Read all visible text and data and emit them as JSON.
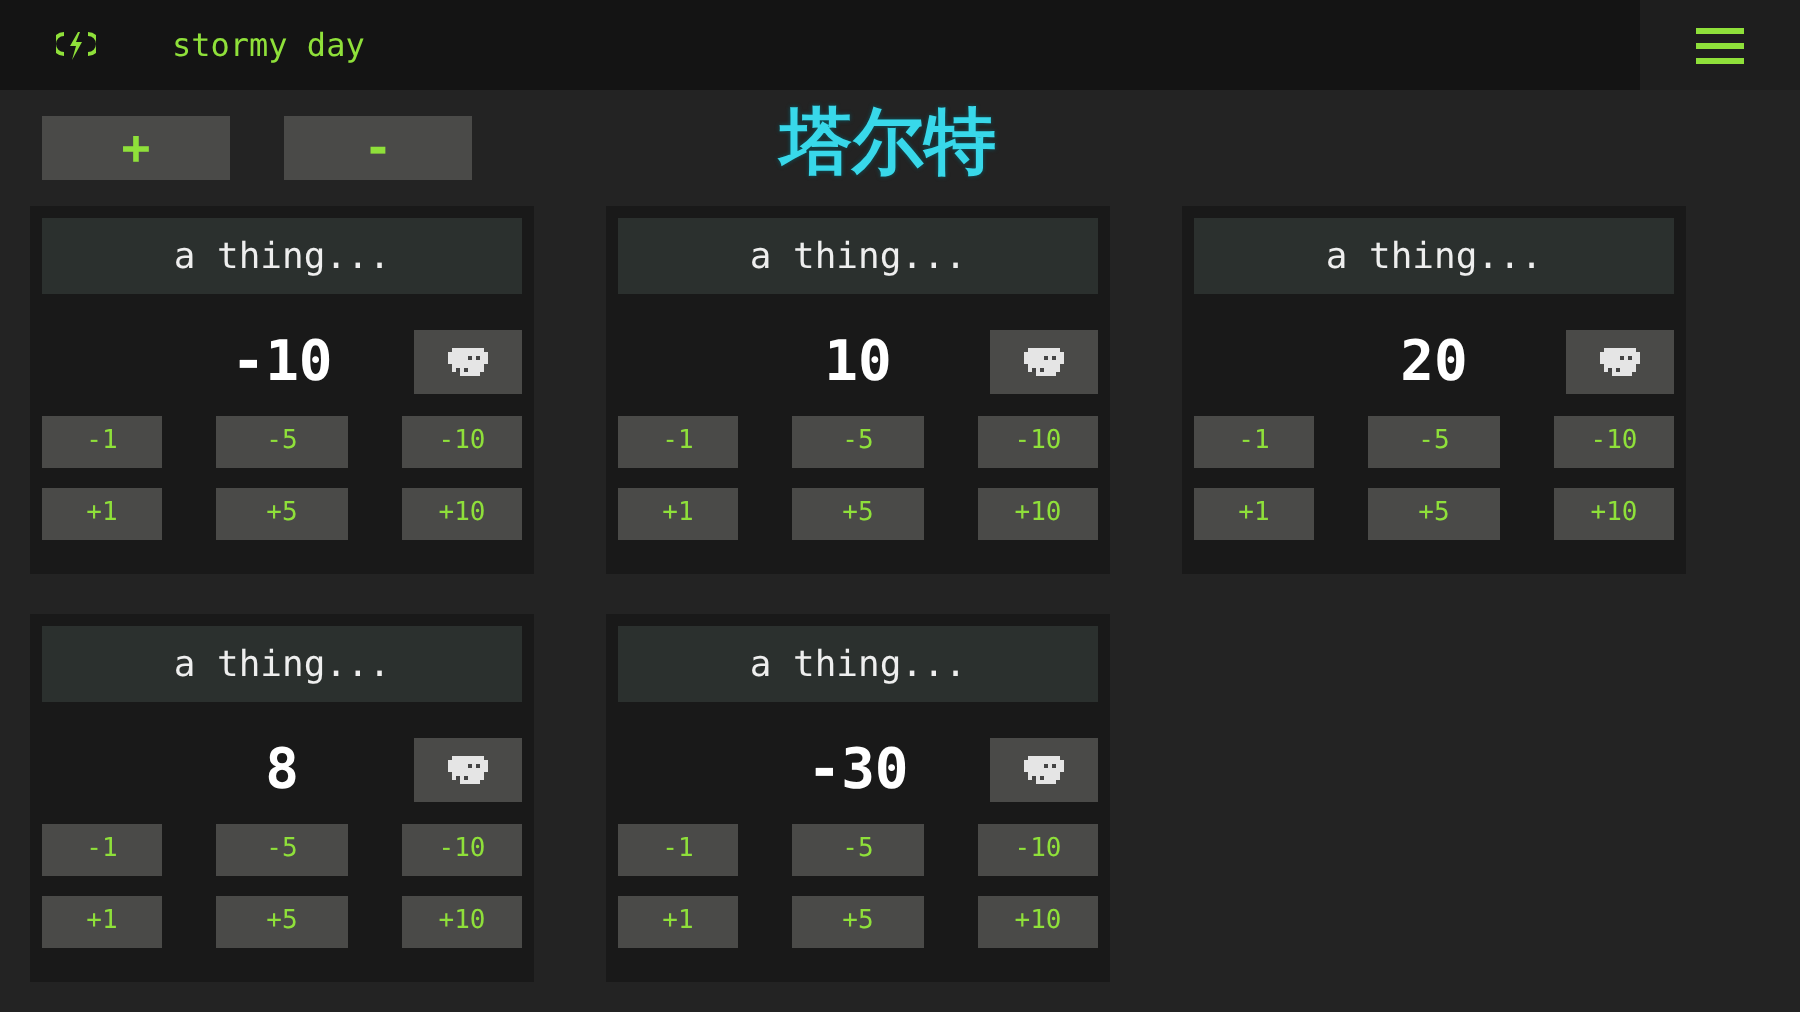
{
  "top_bar": {
    "weather": "stormy day"
  },
  "toolbar": {
    "add": "+",
    "remove": "-"
  },
  "title": "塔尔特",
  "counters": [
    {
      "name": "a thing...",
      "value": "-10",
      "minus": [
        "-1",
        "-5",
        "-10"
      ],
      "plus": [
        "+1",
        "+5",
        "+10"
      ]
    },
    {
      "name": "a thing...",
      "value": "10",
      "minus": [
        "-1",
        "-5",
        "-10"
      ],
      "plus": [
        "+1",
        "+5",
        "+10"
      ]
    },
    {
      "name": "a thing...",
      "value": "20",
      "minus": [
        "-1",
        "-5",
        "-10"
      ],
      "plus": [
        "+1",
        "+5",
        "+10"
      ]
    },
    {
      "name": "a thing...",
      "value": "8",
      "minus": [
        "-1",
        "-5",
        "-10"
      ],
      "plus": [
        "+1",
        "+5",
        "+10"
      ]
    },
    {
      "name": "a thing...",
      "value": "-30",
      "minus": [
        "-1",
        "-5",
        "-10"
      ],
      "plus": [
        "+1",
        "+5",
        "+10"
      ]
    }
  ]
}
